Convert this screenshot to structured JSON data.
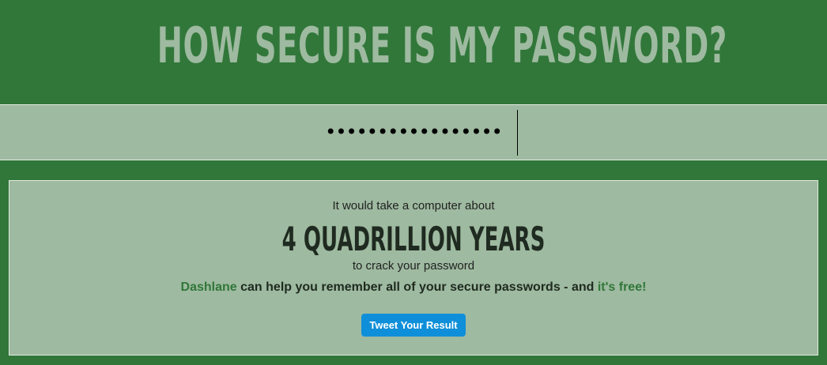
{
  "header": {
    "title": "HOW SECURE IS MY PASSWORD?"
  },
  "password": {
    "value": "•••••••••••••••••"
  },
  "result": {
    "lead": "It would take a computer about",
    "time": "4 QUADRILLION YEARS",
    "tail": "to crack your password",
    "promo_link": "Dashlane",
    "promo_text": " can help you remember all of your secure passwords - and ",
    "promo_free": "it's free!",
    "tweet_label": "Tweet Your Result"
  },
  "colors": {
    "background": "#31773a",
    "panel": "#9ebaa0",
    "title": "#9ebaa0",
    "link": "#31773a",
    "button": "#0f8fd9"
  }
}
